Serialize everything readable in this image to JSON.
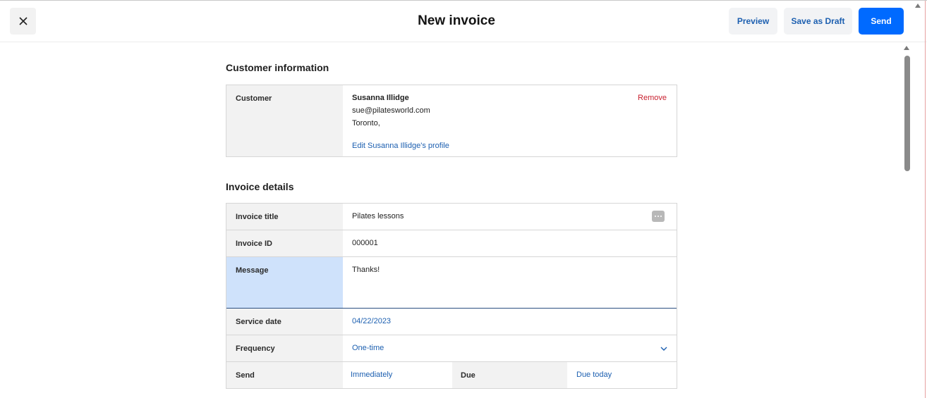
{
  "header": {
    "title": "New invoice",
    "preview_label": "Preview",
    "draft_label": "Save as Draft",
    "send_label": "Send",
    "close_icon": "close-icon"
  },
  "customer_section": {
    "title": "Customer information",
    "label": "Customer",
    "name": "Susanna Illidge",
    "email": "sue@pilatesworld.com",
    "city": "Toronto,",
    "edit_link": "Edit Susanna Illidge's profile",
    "remove_label": "Remove"
  },
  "invoice_section": {
    "title": "Invoice details",
    "invoice_title_label": "Invoice title",
    "invoice_title_value": "Pilates lessons",
    "invoice_id_label": "Invoice ID",
    "invoice_id_value": "000001",
    "message_label": "Message",
    "message_value": "Thanks!",
    "service_date_label": "Service date",
    "service_date_value": "04/22/2023",
    "frequency_label": "Frequency",
    "frequency_value": "One-time",
    "send_label": "Send",
    "send_value": "Immediately",
    "due_label": "Due",
    "due_value": "Due today"
  },
  "colors": {
    "accent": "#006aff",
    "link": "#1c5fb0",
    "danger": "#c8202f",
    "focus_label_bg": "#cfe2fb"
  }
}
